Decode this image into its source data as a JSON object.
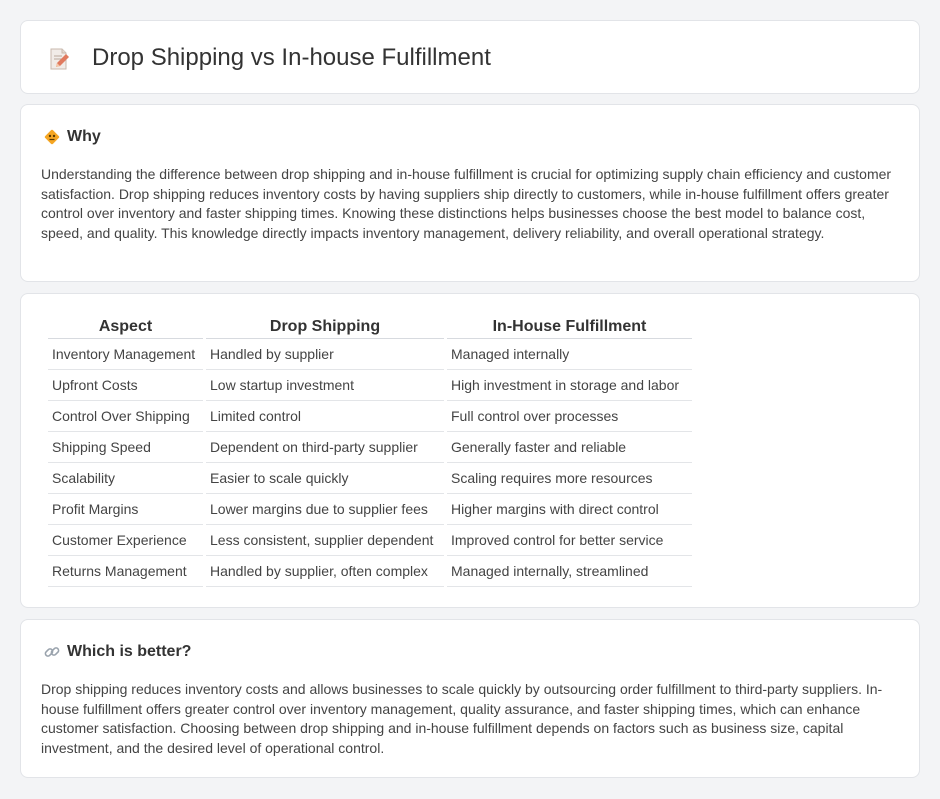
{
  "header": {
    "title": "Drop Shipping vs In-house Fulfillment",
    "icon": "document-pencil-icon"
  },
  "why": {
    "title": "Why",
    "icon": "warning-sign-icon",
    "text": "Understanding the difference between drop shipping and in-house fulfillment is crucial for optimizing supply chain efficiency and customer satisfaction. Drop shipping reduces inventory costs by having suppliers ship directly to customers, while in-house fulfillment offers greater control over inventory and faster shipping times. Knowing these distinctions helps businesses choose the best model to balance cost, speed, and quality. This knowledge directly impacts inventory management, delivery reliability, and overall operational strategy."
  },
  "table": {
    "headers": [
      "Aspect",
      "Drop Shipping",
      "In-House Fulfillment"
    ],
    "rows": [
      [
        "Inventory Management",
        "Handled by supplier",
        "Managed internally"
      ],
      [
        "Upfront Costs",
        "Low startup investment",
        "High investment in storage and labor"
      ],
      [
        "Control Over Shipping",
        "Limited control",
        "Full control over processes"
      ],
      [
        "Shipping Speed",
        "Dependent on third-party supplier",
        "Generally faster and reliable"
      ],
      [
        "Scalability",
        "Easier to scale quickly",
        "Scaling requires more resources"
      ],
      [
        "Profit Margins",
        "Lower margins due to supplier fees",
        "Higher margins with direct control"
      ],
      [
        "Customer Experience",
        "Less consistent, supplier dependent",
        "Improved control for better service"
      ],
      [
        "Returns Management",
        "Handled by supplier, often complex",
        "Managed internally, streamlined"
      ]
    ]
  },
  "better": {
    "title": "Which is better?",
    "icon": "link-icon",
    "text": "Drop shipping reduces inventory costs and allows businesses to scale quickly by outsourcing order fulfillment to third-party suppliers. In-house fulfillment offers greater control over inventory management, quality assurance, and faster shipping times, which can enhance customer satisfaction. Choosing between drop shipping and in-house fulfillment depends on factors such as business size, capital investment, and the desired level of operational control."
  },
  "colors": {
    "background": "#f3f4f6",
    "card": "#ffffff",
    "text": "#444444",
    "warning_icon": "#f5a623",
    "document_icon": "#e07a5f"
  }
}
